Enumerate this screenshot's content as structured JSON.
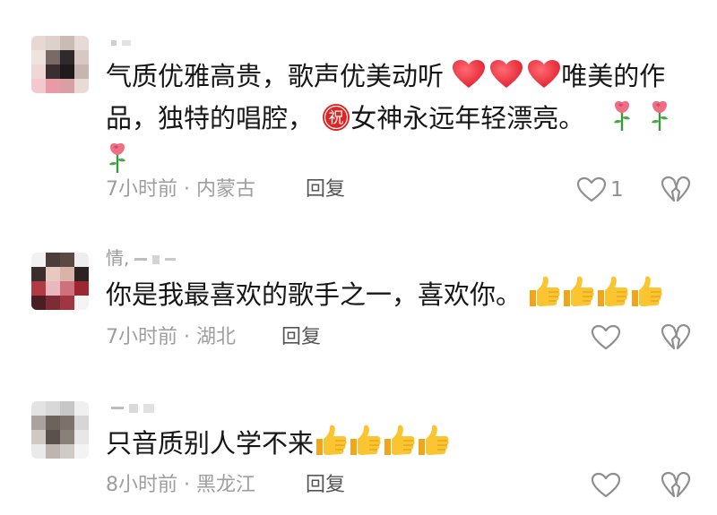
{
  "comments": [
    {
      "username": "",
      "text_parts": [
        "气质优雅高贵，歌声优美动听",
        "唯美的作品，独特的唱腔，",
        "女神永远年轻漂亮。"
      ],
      "time": "7小时前",
      "location": "内蒙古",
      "reply_label": "回复",
      "like_count": "1"
    },
    {
      "username": "情,",
      "text": "你是我最喜欢的歌手之一，喜欢你。",
      "time": "7小时前",
      "location": "湖北",
      "reply_label": "回复",
      "like_count": ""
    },
    {
      "username": "",
      "text": "只音质别人学不来",
      "time": "8小时前",
      "location": "黑龙江",
      "reply_label": "回复",
      "like_count": ""
    }
  ],
  "meta_separator": "·",
  "emoji_names": [
    "red-heart-icon",
    "blessing-badge-icon",
    "rose-icon",
    "thumbs-up-icon"
  ],
  "emoji_badge_char": "祝",
  "colors": {
    "heart": "#ef2d3c",
    "thumb": "#f7b928",
    "rose": "#e8637a",
    "meta": "#9e9e9e",
    "text": "#161616"
  }
}
